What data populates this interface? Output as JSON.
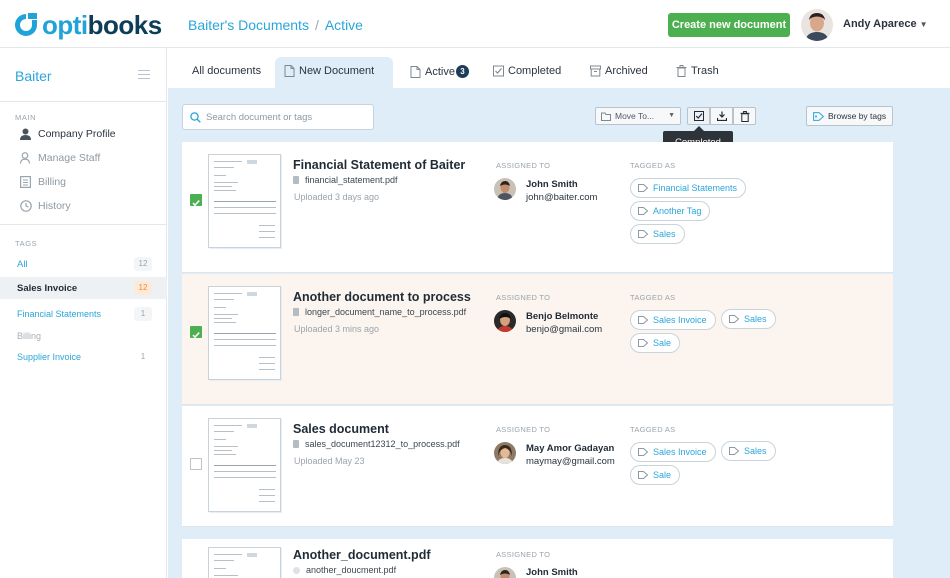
{
  "app": {
    "brand_a": "opti",
    "brand_b": "books",
    "accent": "#1fa3d8",
    "dark": "#0e3e57"
  },
  "breadcrumb": {
    "root": "Baiter's Documents",
    "separator": "/",
    "current": "Active"
  },
  "header": {
    "create_label": "Create new document",
    "user_name": "Andy Aparece",
    "create_color": "#4caf50"
  },
  "sidebar": {
    "title": "Baiter",
    "main_section": "MAIN",
    "items": [
      {
        "label": "Company Profile",
        "icon": "user-icon"
      },
      {
        "label": "Manage Staff",
        "icon": "staff-icon"
      },
      {
        "label": "Billing",
        "icon": "billing-icon"
      },
      {
        "label": "History",
        "icon": "clock-icon"
      }
    ],
    "tags_section": "TAGS",
    "tags": [
      {
        "label": "All",
        "count": "12"
      },
      {
        "label": "Sales Invoice",
        "count": "12"
      },
      {
        "label": "Financial Statements",
        "count": "1"
      },
      {
        "label": "Billing",
        "count": ""
      },
      {
        "label": "Supplier Invoice",
        "count": "1"
      }
    ]
  },
  "tabs": [
    {
      "label": "All documents"
    },
    {
      "label": "New Document",
      "icon": "file-icon"
    },
    {
      "label": "Active",
      "icon": "file-icon",
      "badge": "3"
    },
    {
      "label": "Completed",
      "icon": "check-square-icon"
    },
    {
      "label": "Archived",
      "icon": "archive-icon"
    },
    {
      "label": "Trash",
      "icon": "trash-icon"
    }
  ],
  "toolbar": {
    "search_placeholder": "Search document or tags",
    "move_to": "Move To...",
    "tooltip": "Completed",
    "browse": "Browse by tags"
  },
  "labels": {
    "assigned_to": "ASSIGNED TO",
    "tagged_as": "TAGGED AS"
  },
  "documents": [
    {
      "title": "Financial Statement of Baiter",
      "file": "financial_statement.pdf",
      "uploaded": "Uploaded 3 days ago",
      "checked": true,
      "assignee_name": "John Smith",
      "assignee_email": "john@baiter.com",
      "tags": [
        "Financial Statements",
        "Another Tag",
        "Sales"
      ]
    },
    {
      "title": "Another document to process",
      "file": "longer_document_name_to_process.pdf",
      "uploaded": "Uploaded 3 mins ago",
      "checked": true,
      "assignee_name": "Benjo Belmonte",
      "assignee_email": "benjo@gmail.com",
      "tags": [
        "Sales Invoice",
        "Sales",
        "Sale"
      ]
    },
    {
      "title": "Sales document",
      "file": "sales_document12312_to_process.pdf",
      "uploaded": "Uploaded May 23",
      "checked": false,
      "assignee_name": "May Amor Gadayan",
      "assignee_email": "maymay@gmail.com",
      "tags": [
        "Sales Invoice",
        "Sales",
        "Sale"
      ]
    },
    {
      "title": "Another_document.pdf",
      "file": "another_doucment.pdf",
      "uploaded": "",
      "checked": false,
      "assignee_name": "John Smith",
      "assignee_email": "",
      "tags": []
    }
  ]
}
